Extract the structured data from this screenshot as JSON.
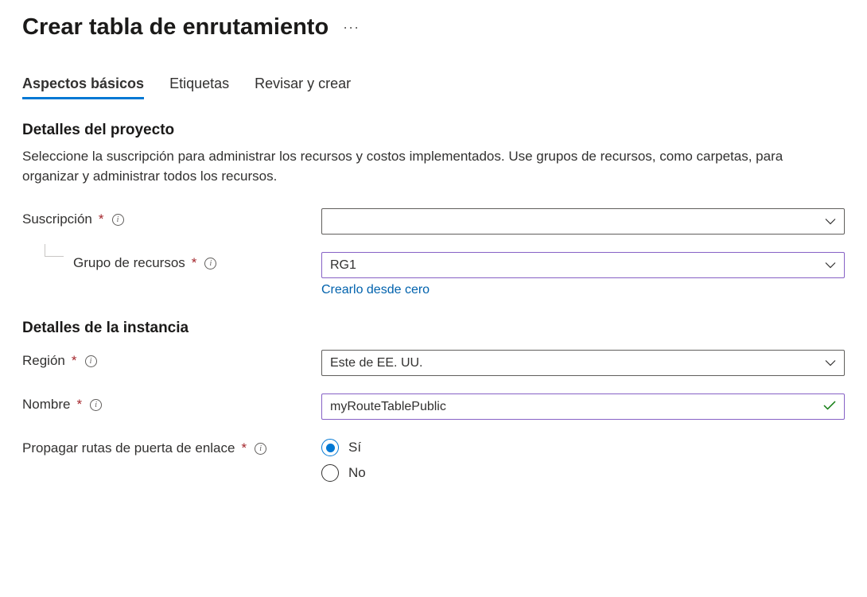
{
  "page": {
    "title": "Crear tabla de enrutamiento"
  },
  "tabs": {
    "basics": "Aspectos básicos",
    "tags": "Etiquetas",
    "review": "Revisar y crear",
    "active": "basics"
  },
  "project": {
    "title": "Detalles del proyecto",
    "intro": "Seleccione la suscripción para administrar los recursos y costos implementados. Use grupos de recursos, como carpetas, para organizar y administrar todos los recursos.",
    "subscription_label": "Suscripción",
    "subscription_value": "",
    "resource_group_label": "Grupo de recursos",
    "resource_group_value": "RG1",
    "create_new_label": "Crearlo desde cero"
  },
  "instance": {
    "title": "Detalles de la instancia",
    "region_label": "Región",
    "region_value": "Este de EE. UU.",
    "name_label": "Nombre",
    "name_value": "myRouteTablePublic",
    "propagate_label": "Propagar rutas de puerta de enlace",
    "propagate_yes": "Sí",
    "propagate_no": "No",
    "propagate_value": "yes"
  }
}
